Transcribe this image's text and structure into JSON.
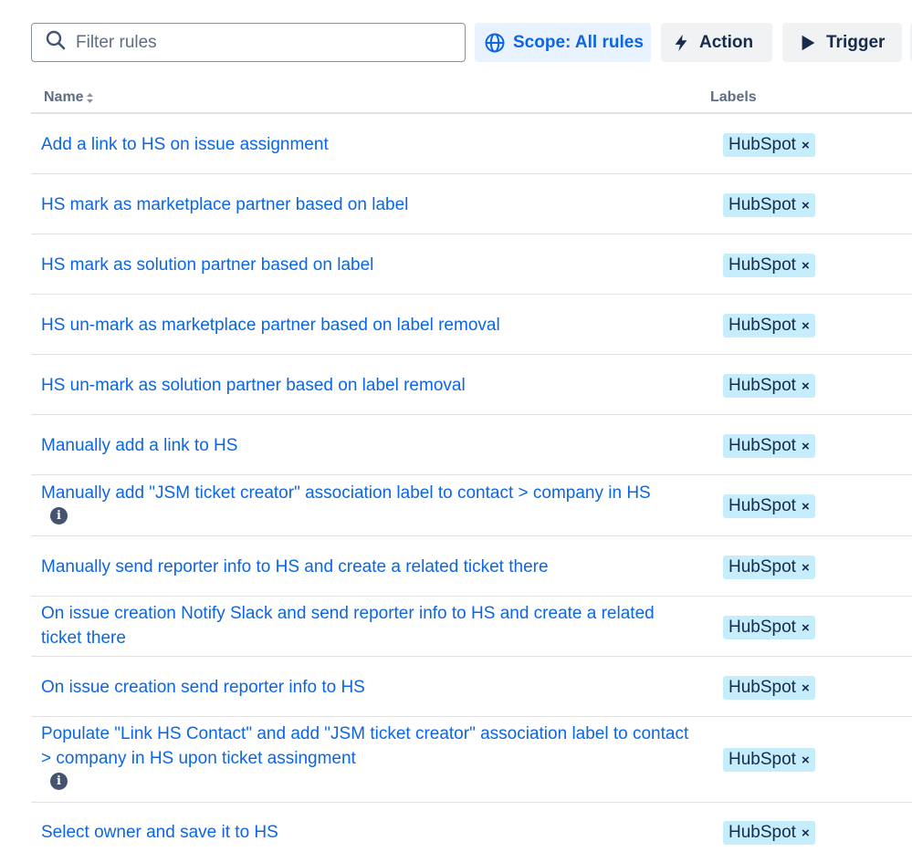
{
  "search": {
    "placeholder": "Filter rules",
    "value": ""
  },
  "buttons": {
    "scope_label": "Scope: All rules",
    "action_label": "Action",
    "trigger_label": "Trigger"
  },
  "table": {
    "columns": {
      "name": "Name",
      "labels": "Labels"
    },
    "rows": [
      {
        "name": "Add a link to HS on issue assignment",
        "label": "HubSpot",
        "info": false
      },
      {
        "name": "HS mark as marketplace partner based on label",
        "label": "HubSpot",
        "info": false
      },
      {
        "name": "HS mark as solution partner based on label",
        "label": "HubSpot",
        "info": false
      },
      {
        "name": "HS un-mark as marketplace partner based on label removal",
        "label": "HubSpot",
        "info": false
      },
      {
        "name": "HS un-mark as solution partner based on label removal",
        "label": "HubSpot",
        "info": false
      },
      {
        "name": "Manually add a link to HS",
        "label": "HubSpot",
        "info": false
      },
      {
        "name": "Manually add \"JSM ticket creator\" association label to contact > company in HS",
        "label": "HubSpot",
        "info": true
      },
      {
        "name": "Manually send reporter info to HS and create a related ticket there",
        "label": "HubSpot",
        "info": false
      },
      {
        "name": "On issue creation Notify Slack and send reporter info to HS and create a related ticket there",
        "label": "HubSpot",
        "info": false
      },
      {
        "name": "On issue creation send reporter info to HS",
        "label": "HubSpot",
        "info": false
      },
      {
        "name": "Populate \"Link HS Contact\" and add \"JSM ticket creator\" association label to contact > company in HS upon ticket assingment",
        "label": "HubSpot",
        "info": true
      },
      {
        "name": "Select owner and save it to HS",
        "label": "HubSpot",
        "info": false
      }
    ]
  },
  "colors": {
    "link": "#0c66e4",
    "lozenge_bg": "#c6edfb",
    "scope_bg": "#e9f2ff"
  },
  "icons": [
    "search-icon",
    "globe-icon",
    "lightning-icon",
    "play-icon",
    "sort-icon",
    "info-icon",
    "remove-label-icon"
  ]
}
